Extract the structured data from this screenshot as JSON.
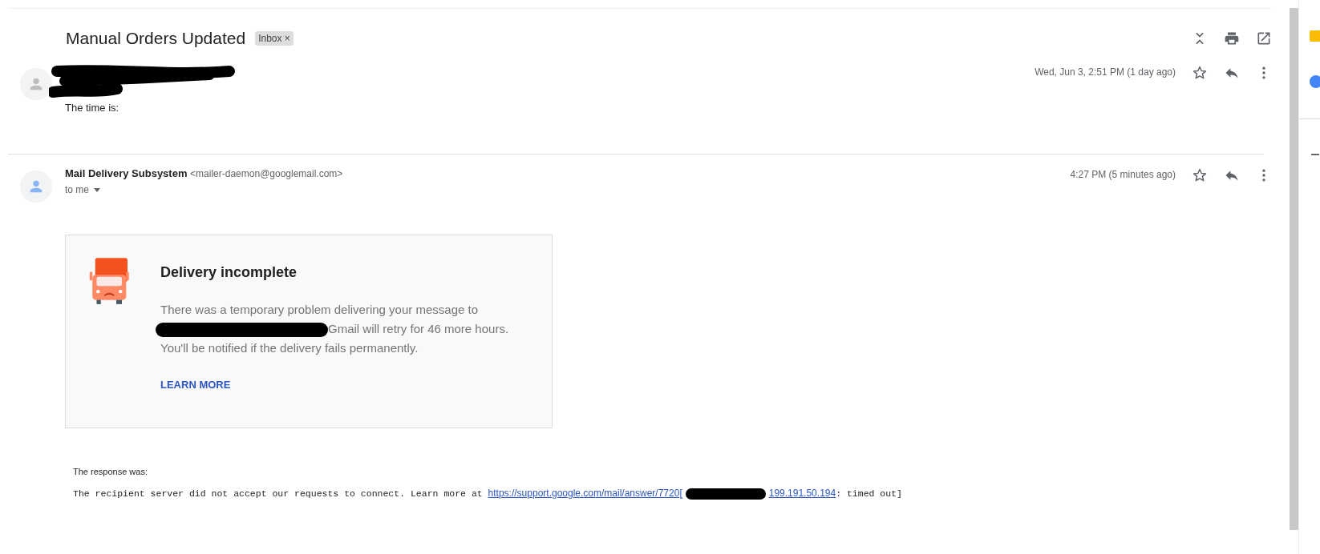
{
  "thread": {
    "subject": "Manual Orders Updated",
    "label": "Inbox",
    "label_close": "×"
  },
  "messages": [
    {
      "sender_redacted": true,
      "color": "#bdbdbd",
      "date": "Wed, Jun 3, 2:51 PM (1 day ago)",
      "body": "The time is:",
      "starred": false
    },
    {
      "sender_redacted": false,
      "color": "#8ab4f8",
      "sender": "Mail Delivery Subsystem",
      "email": "<mailer-daemon@googlemail.com>",
      "recipient": "to me",
      "date": "4:27 PM (5 minutes ago)",
      "starred": false
    }
  ],
  "bounce": {
    "title": "Delivery incomplete",
    "line_1": "There was a temporary problem delivering your message to",
    "line_2": "Gmail will retry for 46 more hours.",
    "line_3": "You'll be notified if the delivery fails permanently.",
    "action": "LEARN MORE"
  },
  "response": {
    "intro": "The response was:",
    "text": "The recipient server did not accept our requests to connect. Learn more at",
    "link": "https://support.google.com/mail/answer/7720[",
    "ip": "199.191.50.194",
    "tail": ": timed out]"
  }
}
